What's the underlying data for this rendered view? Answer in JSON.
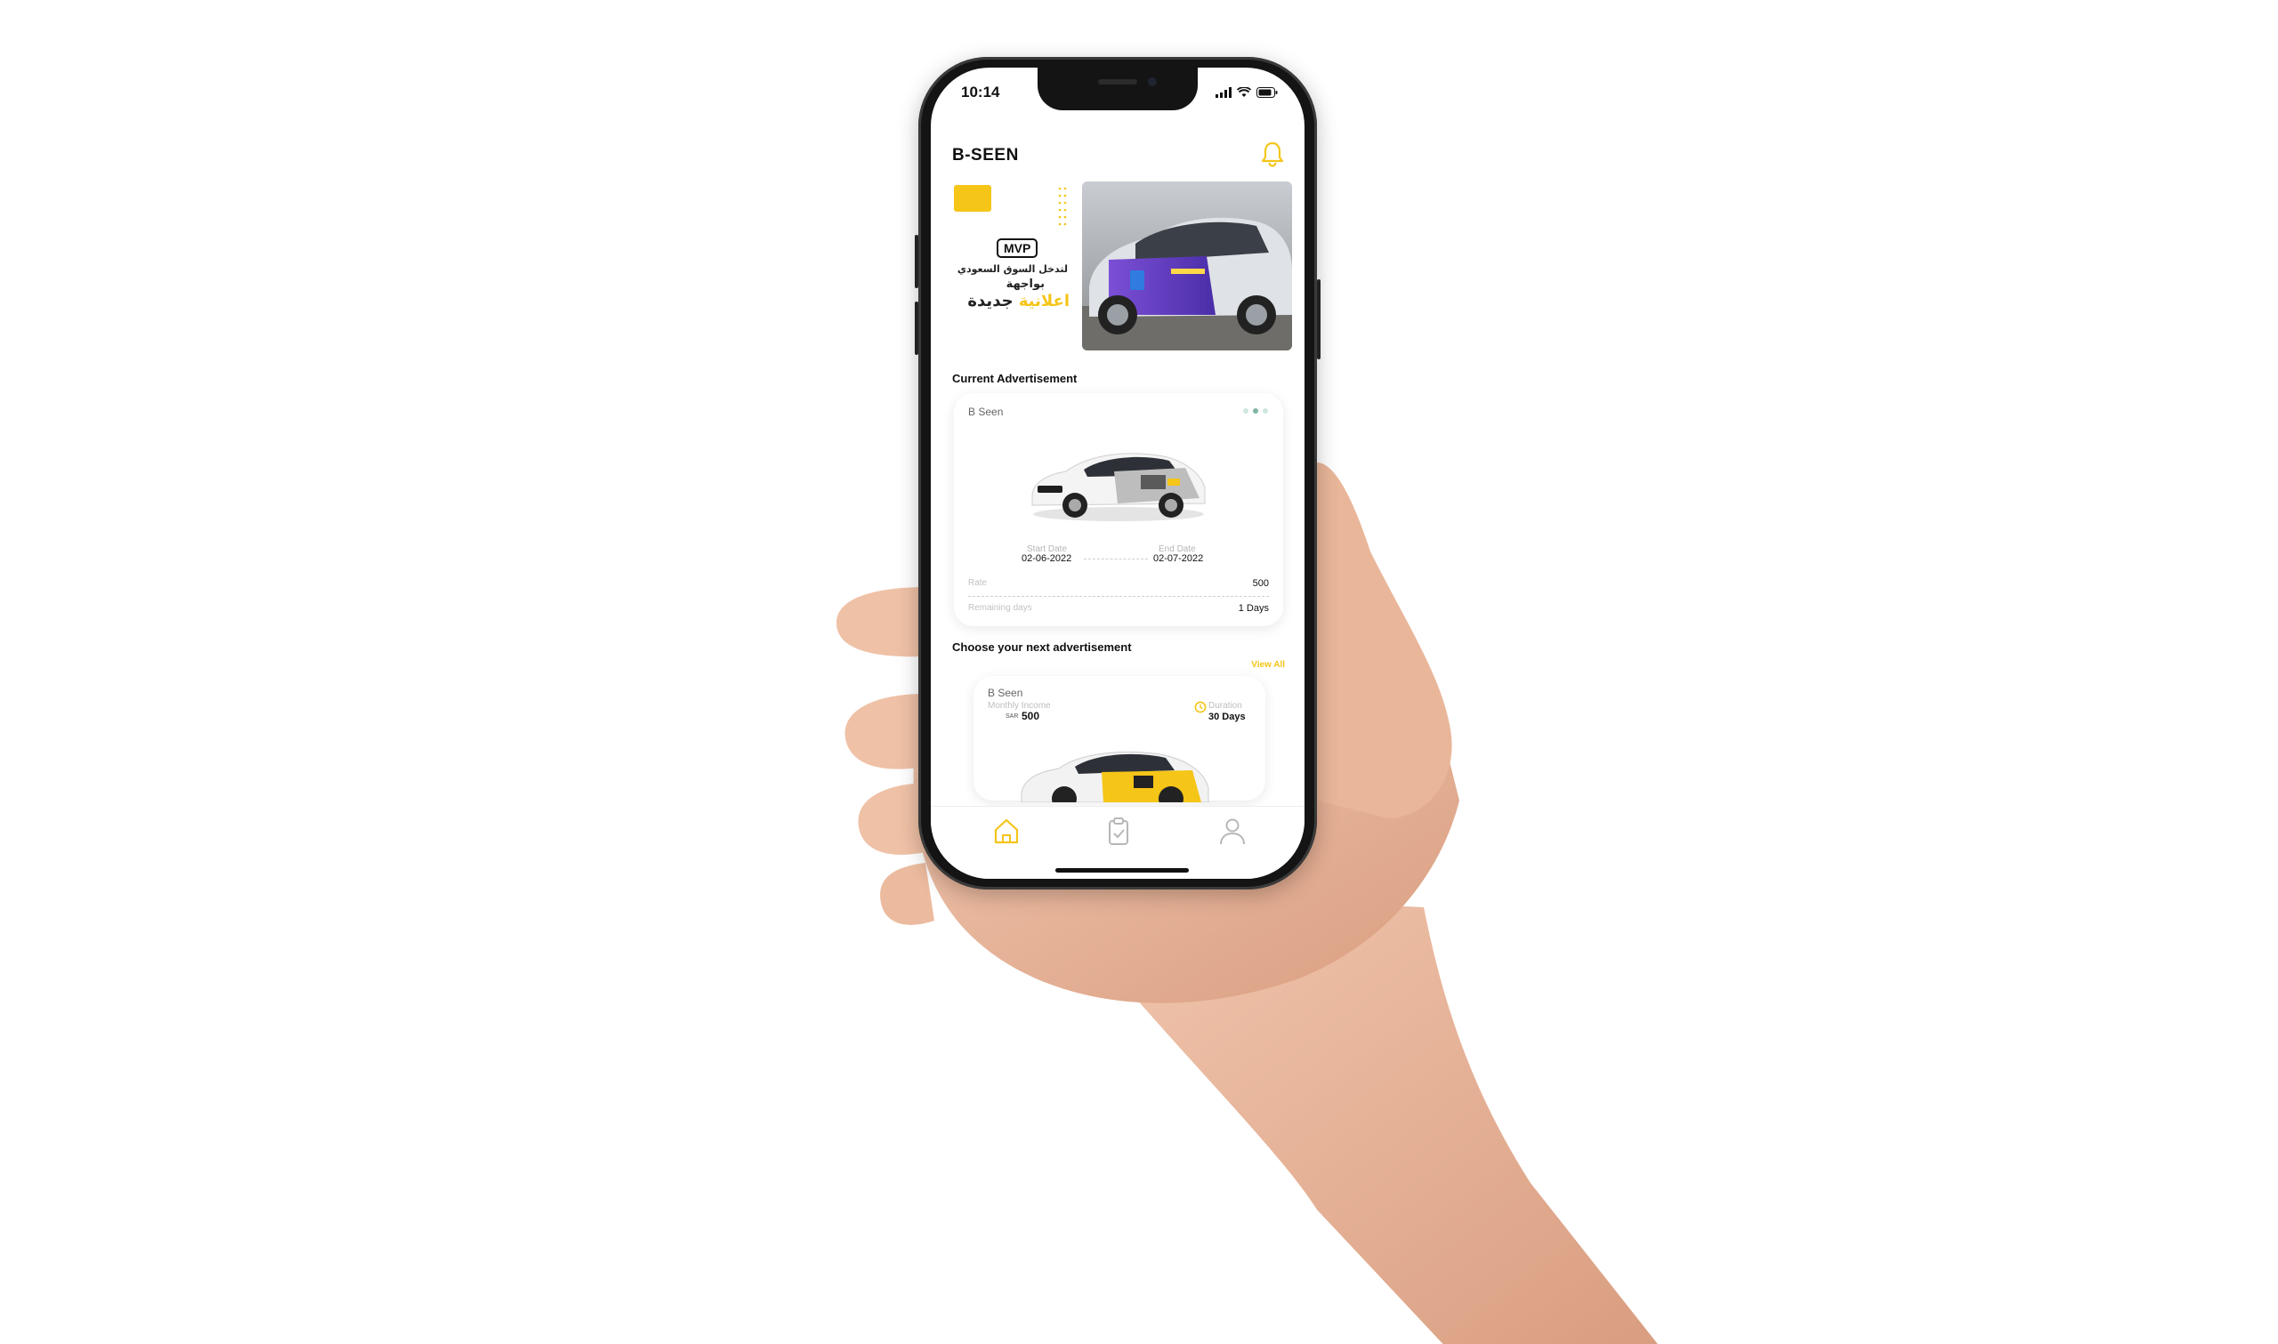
{
  "status_bar": {
    "time": "10:14"
  },
  "app": {
    "brand": "B-SEEN"
  },
  "banner": {
    "badge": "MVP",
    "line1": "لتدخل السوق السعودي",
    "line2": "بواجهة",
    "line3_a": "اعلانية",
    "line3_b": "جديدة"
  },
  "current_ad": {
    "section_title": "Current Advertisement",
    "owner": "B Seen",
    "start_date_label": "Start Date",
    "start_date": "02-06-2022",
    "end_date_label": "End Date",
    "end_date": "02-07-2022",
    "rate_label": "Rate",
    "rate_value": "500",
    "remaining_label": "Remaining days",
    "remaining_value": "1 Days"
  },
  "next_ad": {
    "section_title": "Choose your next advertisement",
    "view_all": "View All",
    "owner": "B Seen",
    "monthly_income_label": "Monthly Income",
    "currency": "SAR",
    "monthly_income_value": "500",
    "duration_label": "Duration",
    "duration_value": "30 Days"
  },
  "nav": {
    "items": [
      "home-icon",
      "clipboard-check-icon",
      "user-icon"
    ]
  },
  "colors": {
    "accent": "#f5c518",
    "text": "#111111",
    "muted": "#999999",
    "skin": "#e8b49a"
  }
}
